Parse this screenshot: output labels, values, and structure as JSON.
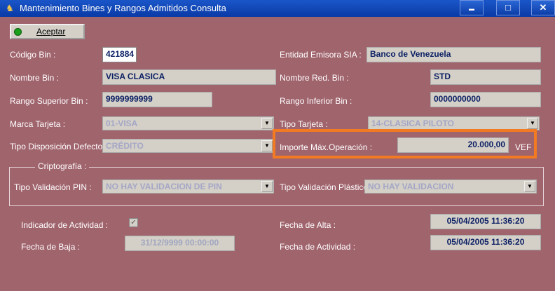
{
  "window": {
    "title": "Mantenimiento Bines y Rangos Admitidos Consulta",
    "min_glyph": "▬",
    "max_glyph": "□",
    "close_glyph": "✕"
  },
  "toolbar": {
    "accept_label": "Aceptar"
  },
  "form": {
    "codigo_bin_label": "Código Bin :",
    "codigo_bin_value": "421884",
    "entidad_label": "Entidad Emisora SIA :",
    "entidad_value": "Banco de Venezuela",
    "nombre_bin_label": "Nombre Bin :",
    "nombre_bin_value": "VISA CLASICA",
    "nombre_red_label": "Nombre Red. Bin :",
    "nombre_red_value": "STD",
    "rango_sup_label": "Rango Superior Bin :",
    "rango_sup_value": "9999999999",
    "rango_inf_label": "Rango Inferior Bin :",
    "rango_inf_value": "0000000000",
    "marca_label": "Marca Tarjeta :",
    "marca_value": "01-VISA",
    "tipo_tarjeta_label": "Tipo Tarjeta :",
    "tipo_tarjeta_value": "14-CLASICA PILOTO",
    "disposicion_label": "Tipo Disposición Defecto :",
    "disposicion_value": "CRÉDITO",
    "importe_label": "Importe Máx.Operación :",
    "importe_value": "20.000,00",
    "importe_currency": "VEF"
  },
  "cripto": {
    "title": "Criptografía :",
    "pin_label": "Tipo Validación PIN :",
    "pin_value": "NO HAY VALIDACION DE PIN",
    "plastico_label": "Tipo Validación Plástico :",
    "plastico_value": "NO HAY VALIDACION"
  },
  "status": {
    "indicador_label": "Indicador de Actividad :",
    "indicador_checked": true,
    "fecha_baja_label": "Fecha de Baja :",
    "fecha_baja_value": "31/12/9999 00:00:00",
    "fecha_alta_label": "Fecha de Alta :",
    "fecha_alta_value": "05/04/2005 11:36:20",
    "fecha_actividad_label": "Fecha de Actividad :",
    "fecha_actividad_value": "05/04/2005 11:36:20"
  },
  "colors": {
    "highlight": "#f27a22",
    "background": "#a0646d"
  }
}
